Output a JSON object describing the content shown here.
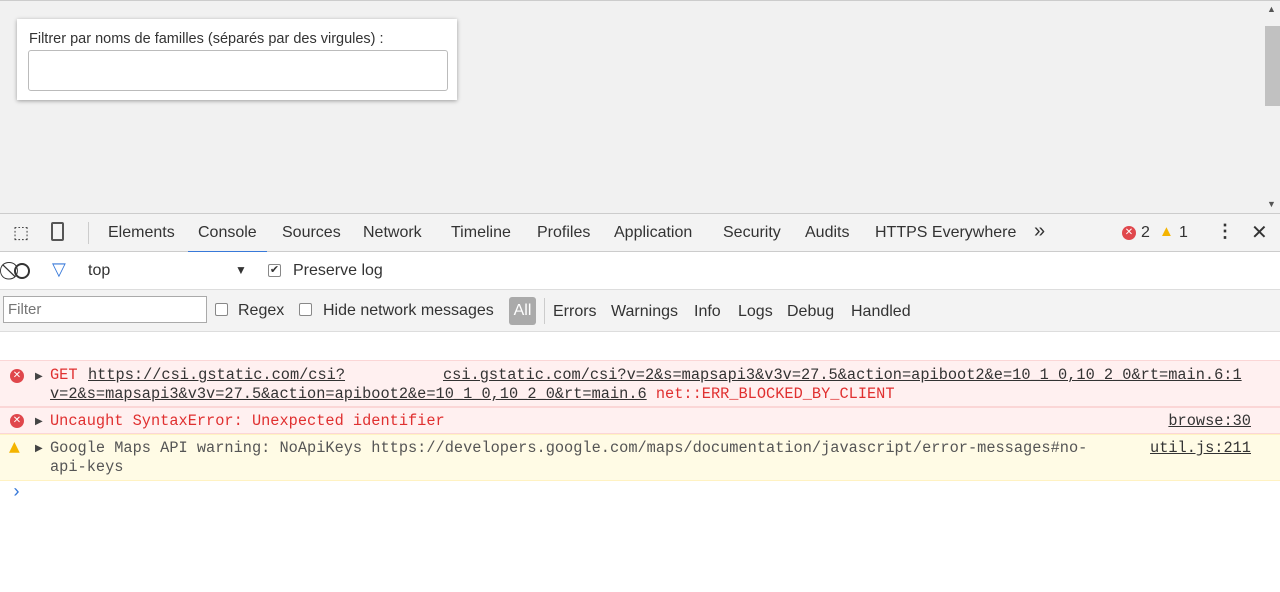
{
  "page": {
    "filter_label": "Filtrer par noms de familles (séparés par des virgules) :",
    "filter_value": ""
  },
  "devtools": {
    "tabs": [
      "Elements",
      "Console",
      "Sources",
      "Network",
      "Timeline",
      "Profiles",
      "Application",
      "Security",
      "Audits",
      "HTTPS Everywhere"
    ],
    "more": "»",
    "error_count": "2",
    "warning_count": "1",
    "context": "top",
    "preserve_log": "Preserve log",
    "filter_placeholder": "Filter",
    "regex": "Regex",
    "hide_network": "Hide network messages",
    "levels": [
      "All",
      "Errors",
      "Warnings",
      "Info",
      "Logs",
      "Debug",
      "Handled"
    ]
  },
  "console": {
    "m1": {
      "method": "GET",
      "url": "https://csi.gstatic.com/csi?",
      "source1": "csi.gstatic.com/csi?v=2&s=mapsapi3&v3v=27.5&action=apiboot2&e=10_1_0,10_2_0&rt=main.6:1",
      "line2": "v=2&s=mapsapi3&v3v=27.5&action=apiboot2&e=10_1_0,10_2_0&rt=main.6",
      "status": "net::ERR_BLOCKED_BY_CLIENT"
    },
    "m2": {
      "text": "Uncaught SyntaxError: Unexpected identifier",
      "source": "browse:30"
    },
    "m3": {
      "text": "Google Maps API warning: NoApiKeys https://developers.google.com/maps/documentation/javascript/error-messages#no-",
      "text2": "api-keys",
      "source": "util.js:211"
    },
    "prompt": "›"
  }
}
